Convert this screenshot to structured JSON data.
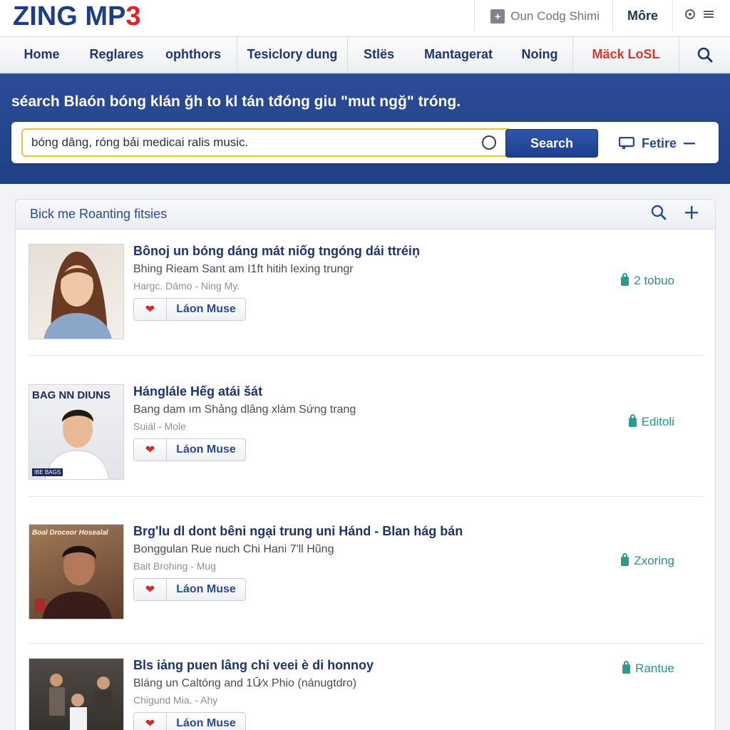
{
  "header": {
    "logo_main": "ZING MP",
    "logo_number": "3",
    "user_label": "Oun Codg Shimi",
    "more_label": "Môre"
  },
  "nav": {
    "items": [
      "Home",
      "Reglares",
      "ophthors",
      "Tesiclory dung",
      "Stlës",
      "Mantagerat",
      "Noing",
      "Mäck LoSL"
    ]
  },
  "search": {
    "headline": "séarch Blaón bóng klán ğh to kl tán tđóng giu \"mut ngğ\" tróng.",
    "value": "bóng dâng, róng bải medicai ralis music.",
    "button_label": "Search",
    "filter_label": "Fetire"
  },
  "panel": {
    "title": "Bick me Roanting fitsies"
  },
  "results": [
    {
      "title": "Bônoj un bóng dáng mát niốg tngóng dái ttréiņ",
      "subtitle": "Bhing Rieam Sant am I1ft hitih lexing trungr",
      "meta": "Hargc. Dámo - Ning My.",
      "listen_label": "Láon Muse",
      "status": "2 tobuo"
    },
    {
      "title": "Hánglále Hếg atái šát",
      "subtitle": "Bang dam ım Shảng dlâng xlàm Sứng trang",
      "meta": "Suiál - Mole",
      "listen_label": "Láon Muse",
      "status": "Editoli",
      "thumb_caption": "BAG NN DIUNS",
      "thumb_tag": "ǀBE BAGS"
    },
    {
      "title": "Brg'lu dl dont bêni ngại trung uni Hánd - Blan hág bán",
      "subtitle": "Bonggulan Rue nuch Chi Hani 7'll Hũng",
      "meta": "Bait Brohing - Mug",
      "listen_label": "Láon Muse",
      "status": "Zxoring",
      "thumb_caption": "Boal Droceor Hosealal"
    },
    {
      "title": "Bls iảng puen lâng chi veei è di honnoy",
      "subtitle": "Bláng un Caltóng and 1Ū⁄x Phio (nánugtdro)",
      "meta": "Chigund Mia. - Ahy",
      "listen_label": "Láon Muse",
      "status": "Rantue"
    }
  ],
  "colors": {
    "brand_blue": "#1f3c86",
    "brand_red": "#d9252b",
    "search_band": "#2c4c97",
    "status_teal": "#2d8f86",
    "like_red": "#d42a2a"
  }
}
